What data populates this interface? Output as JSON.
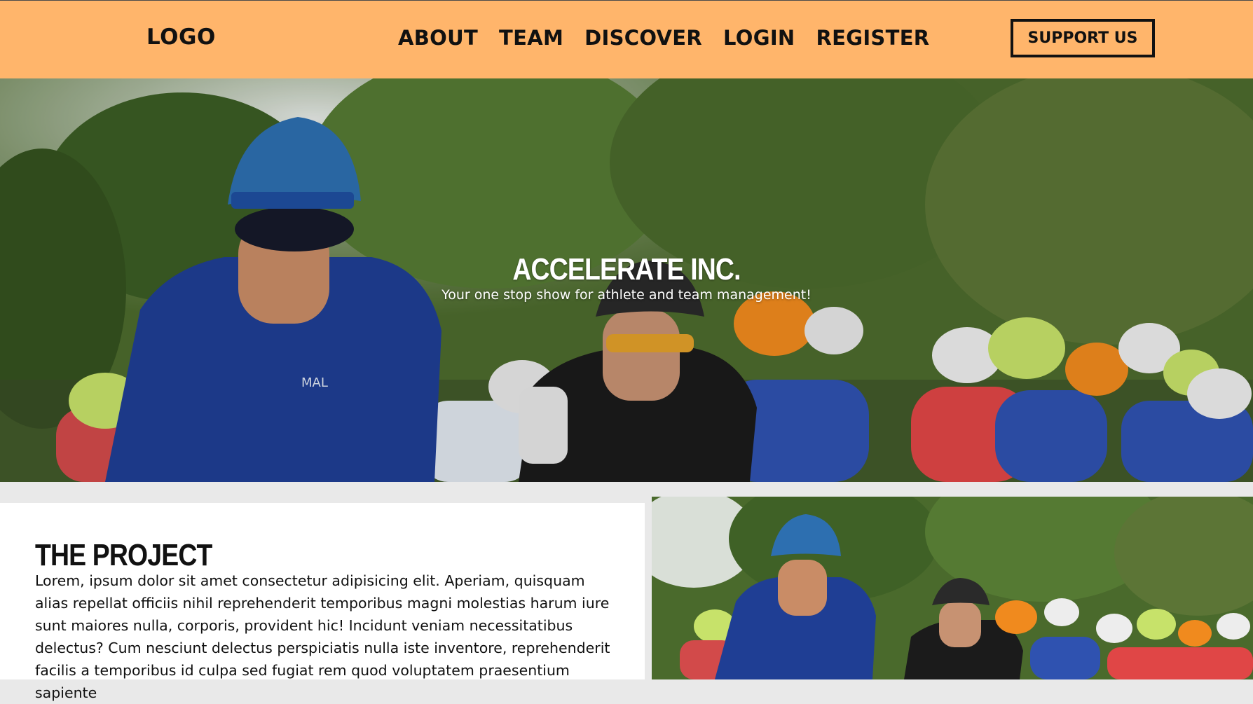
{
  "header": {
    "logo": "LOGO",
    "nav": [
      "ABOUT",
      "TEAM",
      "DISCOVER",
      "LOGIN",
      "REGISTER"
    ],
    "cta": "SUPPORT US"
  },
  "hero": {
    "title": "ACCELERATE INC.",
    "subtitle": "Your one stop show for athlete and team management!"
  },
  "project": {
    "title": "THE PROJECT",
    "body": "Lorem, ipsum dolor sit amet consectetur adipisicing elit. Aperiam, quisquam alias repellat officiis nihil reprehenderit temporibus magni molestias harum iure sunt maiores nulla, corporis, provident hic! Incidunt veniam necessitatibus delectus? Cum nesciunt delectus perspiciatis nulla iste inventore, reprehenderit facilis a temporibus id culpa sed fugiat rem quod voluptatem praesentium sapiente"
  },
  "colors": {
    "header_bg": "#ffb56b",
    "jersey_blue": "#1f3e94",
    "helmet_lime": "#c7e26a",
    "helmet_orange": "#f08a1e",
    "foliage": "#4a6a2c"
  },
  "icons": [
    "hero-cyclists-image",
    "project-cyclists-image"
  ]
}
